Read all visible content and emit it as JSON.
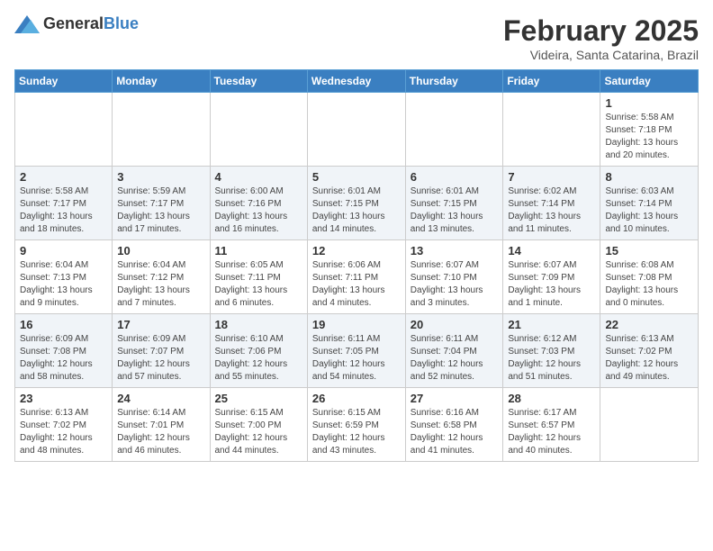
{
  "logo": {
    "general": "General",
    "blue": "Blue"
  },
  "title": "February 2025",
  "subtitle": "Videira, Santa Catarina, Brazil",
  "headers": [
    "Sunday",
    "Monday",
    "Tuesday",
    "Wednesday",
    "Thursday",
    "Friday",
    "Saturday"
  ],
  "weeks": [
    [
      {
        "day": "",
        "info": ""
      },
      {
        "day": "",
        "info": ""
      },
      {
        "day": "",
        "info": ""
      },
      {
        "day": "",
        "info": ""
      },
      {
        "day": "",
        "info": ""
      },
      {
        "day": "",
        "info": ""
      },
      {
        "day": "1",
        "info": "Sunrise: 5:58 AM\nSunset: 7:18 PM\nDaylight: 13 hours and 20 minutes."
      }
    ],
    [
      {
        "day": "2",
        "info": "Sunrise: 5:58 AM\nSunset: 7:17 PM\nDaylight: 13 hours and 18 minutes."
      },
      {
        "day": "3",
        "info": "Sunrise: 5:59 AM\nSunset: 7:17 PM\nDaylight: 13 hours and 17 minutes."
      },
      {
        "day": "4",
        "info": "Sunrise: 6:00 AM\nSunset: 7:16 PM\nDaylight: 13 hours and 16 minutes."
      },
      {
        "day": "5",
        "info": "Sunrise: 6:01 AM\nSunset: 7:15 PM\nDaylight: 13 hours and 14 minutes."
      },
      {
        "day": "6",
        "info": "Sunrise: 6:01 AM\nSunset: 7:15 PM\nDaylight: 13 hours and 13 minutes."
      },
      {
        "day": "7",
        "info": "Sunrise: 6:02 AM\nSunset: 7:14 PM\nDaylight: 13 hours and 11 minutes."
      },
      {
        "day": "8",
        "info": "Sunrise: 6:03 AM\nSunset: 7:14 PM\nDaylight: 13 hours and 10 minutes."
      }
    ],
    [
      {
        "day": "9",
        "info": "Sunrise: 6:04 AM\nSunset: 7:13 PM\nDaylight: 13 hours and 9 minutes."
      },
      {
        "day": "10",
        "info": "Sunrise: 6:04 AM\nSunset: 7:12 PM\nDaylight: 13 hours and 7 minutes."
      },
      {
        "day": "11",
        "info": "Sunrise: 6:05 AM\nSunset: 7:11 PM\nDaylight: 13 hours and 6 minutes."
      },
      {
        "day": "12",
        "info": "Sunrise: 6:06 AM\nSunset: 7:11 PM\nDaylight: 13 hours and 4 minutes."
      },
      {
        "day": "13",
        "info": "Sunrise: 6:07 AM\nSunset: 7:10 PM\nDaylight: 13 hours and 3 minutes."
      },
      {
        "day": "14",
        "info": "Sunrise: 6:07 AM\nSunset: 7:09 PM\nDaylight: 13 hours and 1 minute."
      },
      {
        "day": "15",
        "info": "Sunrise: 6:08 AM\nSunset: 7:08 PM\nDaylight: 13 hours and 0 minutes."
      }
    ],
    [
      {
        "day": "16",
        "info": "Sunrise: 6:09 AM\nSunset: 7:08 PM\nDaylight: 12 hours and 58 minutes."
      },
      {
        "day": "17",
        "info": "Sunrise: 6:09 AM\nSunset: 7:07 PM\nDaylight: 12 hours and 57 minutes."
      },
      {
        "day": "18",
        "info": "Sunrise: 6:10 AM\nSunset: 7:06 PM\nDaylight: 12 hours and 55 minutes."
      },
      {
        "day": "19",
        "info": "Sunrise: 6:11 AM\nSunset: 7:05 PM\nDaylight: 12 hours and 54 minutes."
      },
      {
        "day": "20",
        "info": "Sunrise: 6:11 AM\nSunset: 7:04 PM\nDaylight: 12 hours and 52 minutes."
      },
      {
        "day": "21",
        "info": "Sunrise: 6:12 AM\nSunset: 7:03 PM\nDaylight: 12 hours and 51 minutes."
      },
      {
        "day": "22",
        "info": "Sunrise: 6:13 AM\nSunset: 7:02 PM\nDaylight: 12 hours and 49 minutes."
      }
    ],
    [
      {
        "day": "23",
        "info": "Sunrise: 6:13 AM\nSunset: 7:02 PM\nDaylight: 12 hours and 48 minutes."
      },
      {
        "day": "24",
        "info": "Sunrise: 6:14 AM\nSunset: 7:01 PM\nDaylight: 12 hours and 46 minutes."
      },
      {
        "day": "25",
        "info": "Sunrise: 6:15 AM\nSunset: 7:00 PM\nDaylight: 12 hours and 44 minutes."
      },
      {
        "day": "26",
        "info": "Sunrise: 6:15 AM\nSunset: 6:59 PM\nDaylight: 12 hours and 43 minutes."
      },
      {
        "day": "27",
        "info": "Sunrise: 6:16 AM\nSunset: 6:58 PM\nDaylight: 12 hours and 41 minutes."
      },
      {
        "day": "28",
        "info": "Sunrise: 6:17 AM\nSunset: 6:57 PM\nDaylight: 12 hours and 40 minutes."
      },
      {
        "day": "",
        "info": ""
      }
    ]
  ]
}
